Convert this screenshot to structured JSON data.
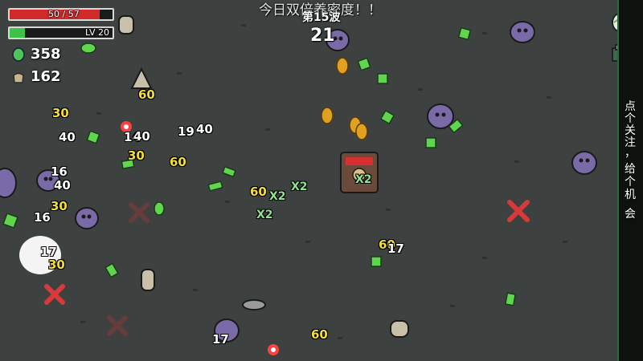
{
  "hud": {
    "hp_text": "50 / 57",
    "hp_current": 50,
    "hp_max": 57,
    "level_text": "LV 20",
    "xp_fraction": 0.15,
    "materials_count": "358",
    "bag_count": "162"
  },
  "banner": {
    "text": "今日双倍养密度！！",
    "wave_label": "第15波",
    "timer": "21"
  },
  "sidebar": {
    "chars": [
      "点",
      "个",
      "关",
      "注",
      "，",
      "给",
      "个",
      "机",
      "会"
    ]
  },
  "damage_numbers": [
    {
      "text": "30",
      "color": "yellow"
    },
    {
      "text": "40",
      "color": "white"
    },
    {
      "text": "60",
      "color": "yellow"
    },
    {
      "text": "19",
      "color": "white"
    },
    {
      "text": "40",
      "color": "white"
    },
    {
      "text": "14",
      "color": "white"
    },
    {
      "text": "40",
      "color": "white"
    },
    {
      "text": "30",
      "color": "yellow"
    },
    {
      "text": "60",
      "color": "yellow"
    },
    {
      "text": "16",
      "color": "white"
    },
    {
      "text": "40",
      "color": "white"
    },
    {
      "text": "30",
      "color": "yellow"
    },
    {
      "text": "16",
      "color": "white"
    },
    {
      "text": "17",
      "color": "white"
    },
    {
      "text": "30",
      "color": "yellow"
    },
    {
      "text": "60",
      "color": "yellow"
    },
    {
      "text": "17",
      "color": "white"
    },
    {
      "text": "60",
      "color": "yellow"
    },
    {
      "text": "17",
      "color": "white"
    },
    {
      "text": "60",
      "color": "yellow"
    },
    {
      "text": "X2",
      "color": "green"
    },
    {
      "text": "X2",
      "color": "green"
    },
    {
      "text": "X2",
      "color": "green"
    },
    {
      "text": "X2",
      "color": "green"
    },
    {
      "text": "X2",
      "color": "green"
    }
  ],
  "colors": {
    "hp_fill": "#d02a2a",
    "xp_fill": "#3fc24a",
    "ground": "#3c403f",
    "alien": "#7a6aa8",
    "material": "#6be05a",
    "fruit": "#e0a020",
    "cross": "#d83a3a"
  },
  "icons": [
    "material-icon",
    "bag-icon",
    "egg-icon",
    "shop-icon"
  ]
}
